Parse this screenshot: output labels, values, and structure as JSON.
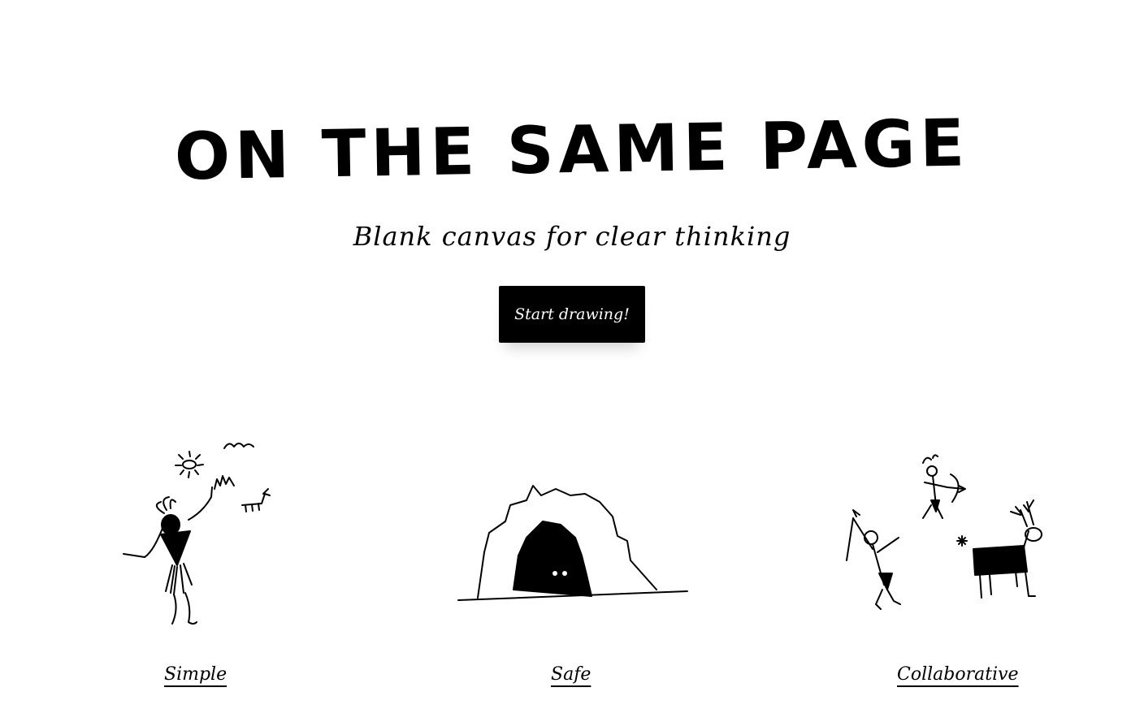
{
  "hero": {
    "title": "ON THE SAME PAGE",
    "subtitle": "Blank canvas for clear thinking",
    "cta_label": "Start drawing!"
  },
  "features": [
    {
      "label": "Simple",
      "icon": "caveman-with-sun-icon"
    },
    {
      "label": "Safe",
      "icon": "cave-icon"
    },
    {
      "label": "Collaborative",
      "icon": "hunters-with-deer-icon"
    }
  ]
}
